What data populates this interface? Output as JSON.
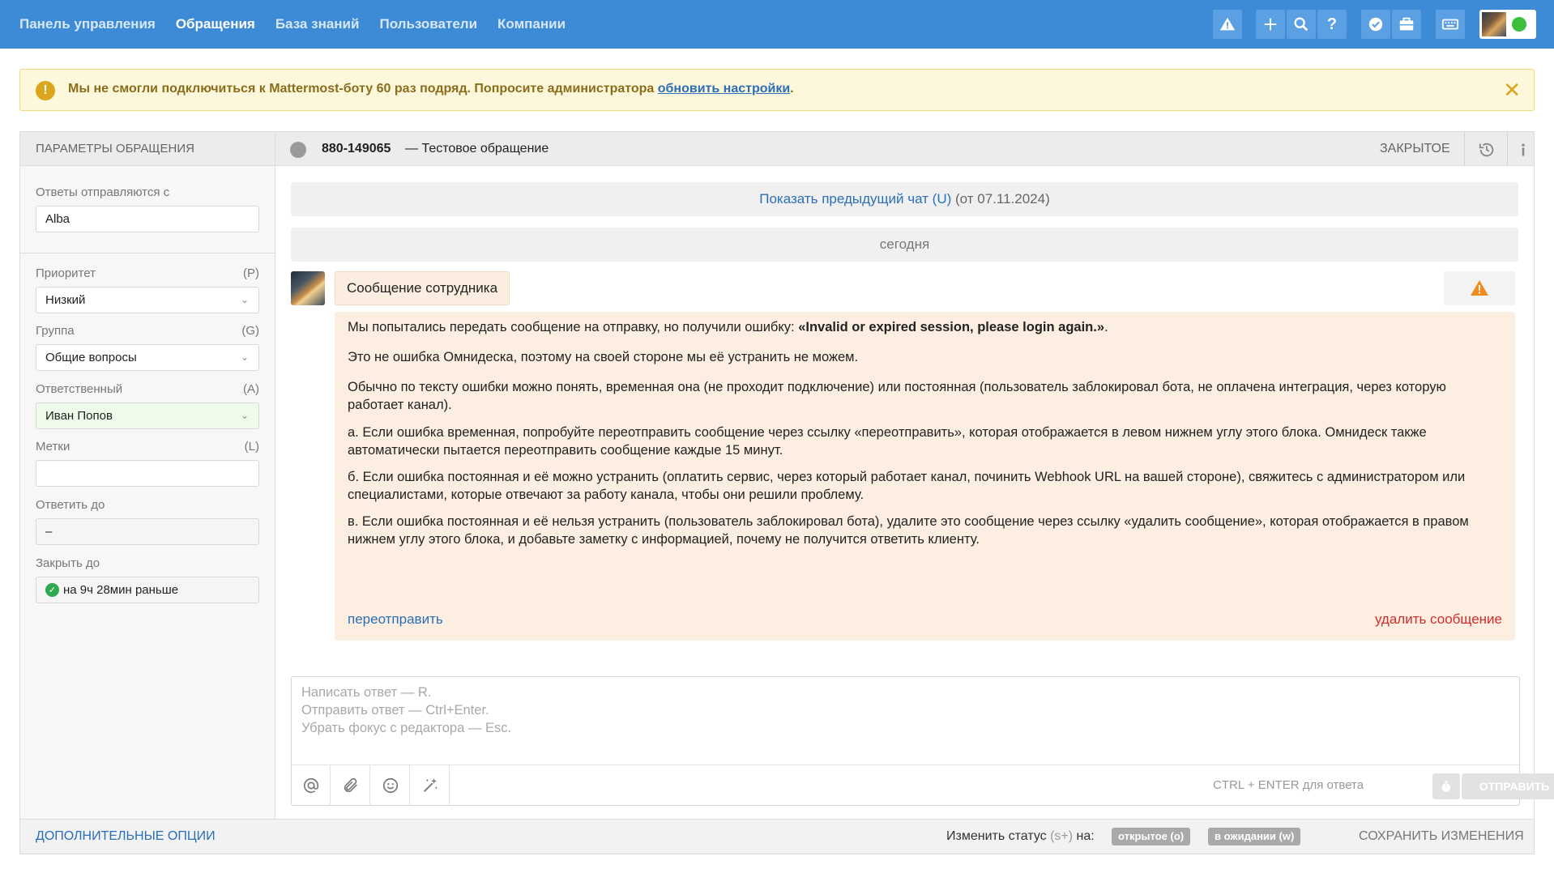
{
  "nav": {
    "items": [
      {
        "label": "Панель управления",
        "active": false
      },
      {
        "label": "Обращения",
        "active": true
      },
      {
        "label": "База знаний",
        "active": false
      },
      {
        "label": "Пользователи",
        "active": false
      },
      {
        "label": "Компании",
        "active": false
      }
    ],
    "toolbar_icons": [
      "warning-icon",
      "plus-icon",
      "search-icon",
      "help-icon",
      "check-circle-icon",
      "briefcase-icon",
      "keyboard-icon"
    ],
    "help_glyph": "?"
  },
  "alert": {
    "icon_glyph": "!",
    "text": "Мы не смогли подключиться к Mattermost-боту 60 раз подряд. Попросите администратора ",
    "link": "обновить настройки",
    "text_end": ".",
    "close_glyph": "✕"
  },
  "params": {
    "header": "ПАРАМЕТРЫ ОБРАЩЕНИЯ",
    "reply_from": {
      "label": "Ответы отправляются с",
      "value": "Alba"
    },
    "priority": {
      "label": "Приоритет",
      "key": "(P)",
      "value": "Низкий"
    },
    "group": {
      "label": "Группа",
      "key": "(G)",
      "value": "Общие вопросы"
    },
    "assignee": {
      "label": "Ответственный",
      "key": "(A)",
      "value": "Иван Попов"
    },
    "tags": {
      "label": "Метки",
      "key": "(L)",
      "value": ""
    },
    "reply_until": {
      "label": "Ответить до",
      "value": "–"
    },
    "close_until": {
      "label": "Закрыть до",
      "value": "на 9ч 28мин раньше"
    },
    "chevron_glyph": "⌄",
    "ok_glyph": "✓"
  },
  "case": {
    "id": "880-149065",
    "separator": "—",
    "title": "Тестовое обращение",
    "status": "ЗАКРЫТОЕ"
  },
  "chat": {
    "prev_link": "Показать предыдущий чат (U)",
    "prev_date": "(от 07.11.2024)",
    "today": "сегодня",
    "message_badge": "Сообщение сотрудника",
    "error": {
      "p1_start": "Мы попытались передать сообщение на отправку, но получили ошибку: ",
      "p1_bold": "«Invalid or expired session, please login again.»",
      "p1_end": ".",
      "p2": "Это не ошибка Омнидеска, поэтому на своей стороне мы её устранить не можем.",
      "p3": "Обычно по тексту ошибки можно понять, временная она (не проходит подключение) или постоянная (пользователь заблокировал бота, не оплачена интеграция, через которую работает канал).",
      "p4": "а. Если ошибка временная, попробуйте переотправить сообщение через ссылку «переотправить», которая отображается в левом нижнем углу этого блока. Омнидеск также автоматически пытается переотправить сообщение каждые 15 минут.",
      "p5": "б. Если ошибка постоянная и её можно устранить (оплатить сервис, через который работает канал, починить Webhook URL на вашей стороне), свяжитесь с администратором или специалистами, которые отвечают за работу канала, чтобы они решили проблему.",
      "p6": "в. Если ошибка постоянная и её нельзя устранить (пользователь заблокировал бота), удалите это сообщение через ссылку «удалить сообщение», которая отображается в правом нижнем углу этого блока, и добавьте заметку с информацией, почему не получится ответить клиенту.",
      "resend": "переотправить",
      "delete": "удалить сообщение"
    }
  },
  "editor": {
    "placeholder_lines": [
      "Написать ответ — R.",
      "Отправить ответ — Ctrl+Enter.",
      "Убрать фокус с редактора — Esc."
    ],
    "tools": [
      "mention-icon",
      "attachment-icon",
      "emoji-icon",
      "magic-wand-icon"
    ],
    "hint": "CTRL + ENTER для ответа",
    "send": "ОТПРАВИТЬ"
  },
  "footer": {
    "more_options": "ДОПОЛНИТЕЛЬНЫЕ ОПЦИИ",
    "change_status_label": "Изменить статус",
    "change_status_key": "(s+)",
    "change_status_suffix": "на:",
    "status_open": "открытое (o)",
    "status_pending": "в ожидании (w)",
    "save": "СОХРАНИТЬ ИЗМЕНЕНИЯ"
  },
  "colors": {
    "topbar": "#3d8bd6",
    "accent_link": "#2a6fb8",
    "alert_bg": "#fdf7dc",
    "error_bg": "#fdeee2",
    "delete_red": "#d62b2b",
    "online_green": "#3cbf3c"
  }
}
